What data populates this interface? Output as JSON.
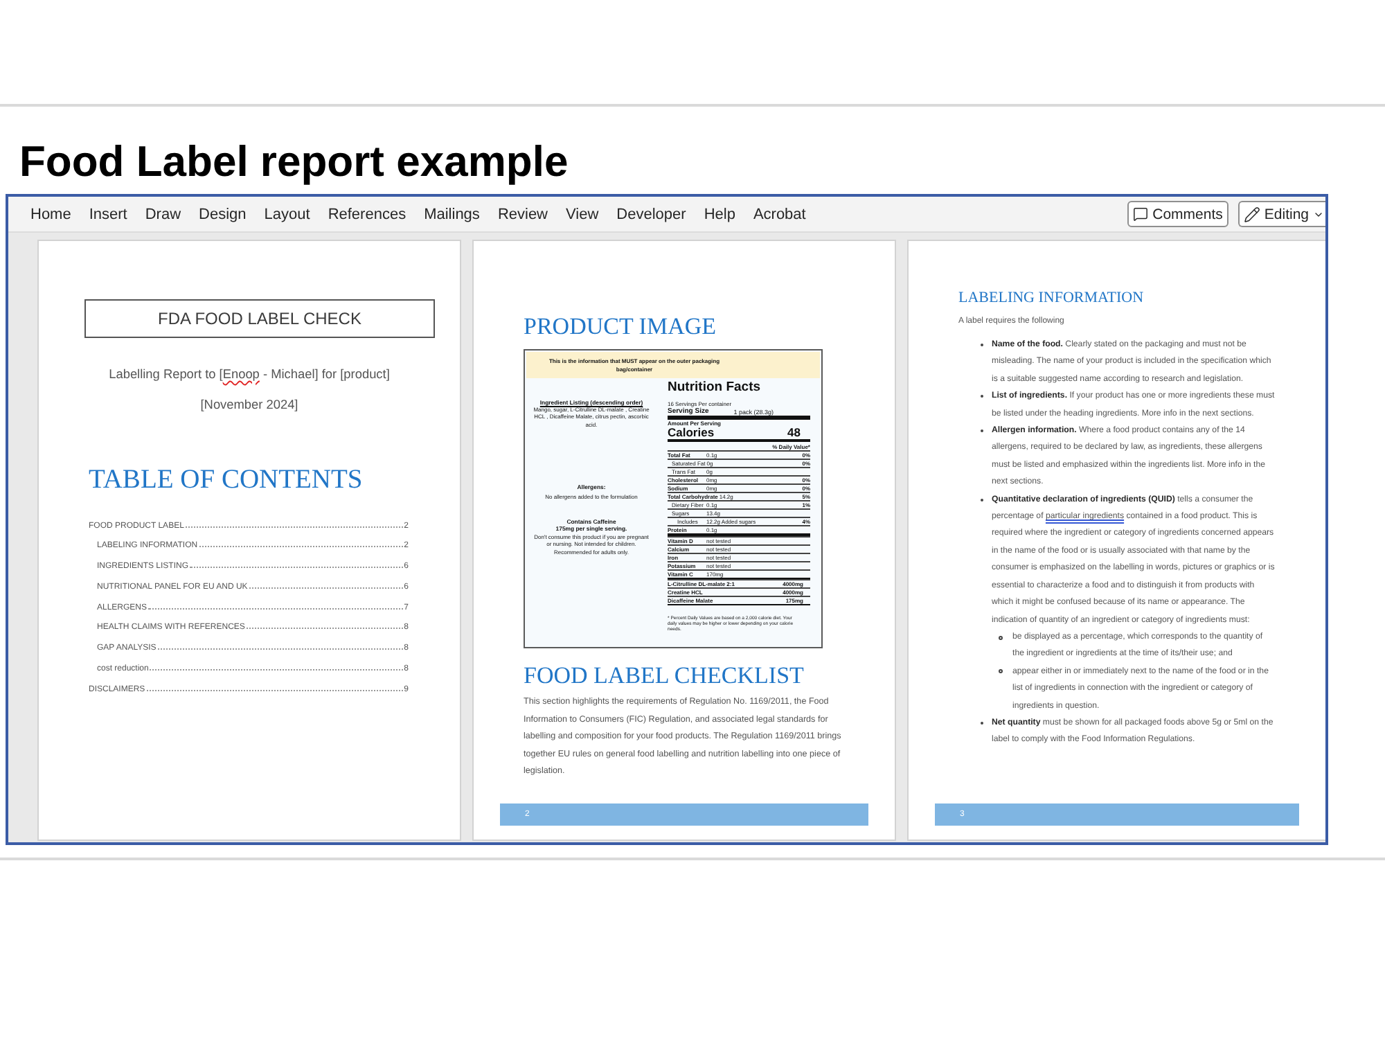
{
  "title": "Food Label report example",
  "ribbon": {
    "tabs": [
      "Home",
      "Insert",
      "Draw",
      "Design",
      "Layout",
      "References",
      "Mailings",
      "Review",
      "View",
      "Developer",
      "Help",
      "Acrobat"
    ],
    "comments_button": "Comments",
    "editing_button": "Editing"
  },
  "page_1": {
    "title_box": "FDA FOOD LABEL CHECK",
    "subtitle": [
      {
        "kind": "text",
        "text": "Labelling Report to ["
      },
      {
        "kind": "spelling_flag",
        "text": "Enoop"
      },
      {
        "kind": "text",
        "text": " - Michael] for [product]"
      }
    ],
    "date": "[November 2024]",
    "toc_heading": "TABLE OF CONTENTS",
    "toc": [
      {
        "title": "FOOD PRODUCT LABEL",
        "page": "2",
        "children": [
          {
            "title": "LABELING INFORMATION",
            "page": "2"
          },
          {
            "title": "INGREDIENTS LISTING",
            "page": "6"
          },
          {
            "title": "NUTRITIONAL PANEL FOR EU AND UK",
            "page": "6"
          },
          {
            "title": "ALLERGENS",
            "page": "7"
          },
          {
            "title": "HEALTH CLAIMS WITH REFERENCES",
            "page": "8"
          },
          {
            "title": "GAP ANALYSIS",
            "page": "8"
          },
          {
            "title": "cost reduction",
            "page": "8"
          }
        ]
      },
      {
        "title": "DISCLAIMERS",
        "page": "9"
      }
    ]
  },
  "page_2": {
    "image_heading": "PRODUCT IMAGE",
    "nutrition_label": {
      "banner": "This is the information that MUST appear on the outer packaging bag/container",
      "ingredients_heading": "Ingredient Listing (descending order)",
      "ingredients": "Mango, sugar, L-Citrulline DL-malate , Creatine HCL , Dicaffeine Malate, citrus pectin, ascorbic acid.",
      "allergens_heading": "Allergens:",
      "allergens": "No allergens added to the formulation",
      "caffeine_heading": "Contains Caffeine",
      "caffeine_amount": "175mg per single serving.",
      "caffeine_warning": "Don't consume this product if you are pregnant or nursing. Not intended for children. Recommended for adults only.",
      "facts_title": "Nutrition Facts",
      "servings": "16 Servings Per container",
      "serving_size_label": "Serving Size",
      "serving_size": "1 pack (28.3g)",
      "amount_per_serving": "Amount Per Serving",
      "calories_label": "Calories",
      "calories": "48",
      "daily_value_heading": "% Daily Value*",
      "nutrients": [
        {
          "kind": "main",
          "name": "Total Fat",
          "amount": "0.1g",
          "dv": "0%"
        },
        {
          "kind": "sub",
          "name": "Saturated Fat",
          "amount": "0g",
          "dv": "0%"
        },
        {
          "kind": "sub",
          "name": "Trans Fat",
          "amount": "0g"
        },
        {
          "kind": "main",
          "name": "Cholesterol",
          "amount": "0mg",
          "dv": "0%"
        },
        {
          "kind": "main",
          "name": "Sodium",
          "amount": "0mg",
          "dv": "0%"
        },
        {
          "kind": "main",
          "name": "Total Carbohydrate",
          "amount": "14.2g",
          "dv": "5%"
        },
        {
          "kind": "sub",
          "name": "Dietary Fiber",
          "amount": "0.1g",
          "dv": "1%"
        },
        {
          "kind": "sub",
          "name": "Sugars",
          "amount": "13.4g"
        },
        {
          "kind": "subsub",
          "name": "Includes",
          "amount": "12.2g Added sugars",
          "dv": "4%"
        },
        {
          "kind": "main",
          "name": "Protein",
          "amount": "0.1g"
        }
      ],
      "vitamins": [
        {
          "name": "Vitamin D",
          "amount": "not tested"
        },
        {
          "name": "Calcium",
          "amount": "not tested"
        },
        {
          "name": "Iron",
          "amount": "not tested"
        },
        {
          "name": "Potassium",
          "amount": "not tested"
        },
        {
          "name": "Vitamin C",
          "amount": "170mg"
        }
      ],
      "actives": [
        {
          "name": "L-Citrulline DL-malate 2:1",
          "amount": "4000mg"
        },
        {
          "name": "Creatine HCL",
          "amount": "4000mg"
        },
        {
          "name": "Dicaffeine Malate",
          "amount": "175mg"
        }
      ],
      "footnote": "* Percent Daily Values are based on a 2,000 calorie diet. Your daily values may be higher or lower depending on your calorie needs."
    },
    "checklist_heading": "FOOD LABEL CHECKLIST",
    "paragraph": "This section highlights the requirements of Regulation No. 1169/2011, the Food Information to Consumers (FIC) Regulation, and associated legal standards for labelling and composition for your food products. The Regulation 1169/2011 brings together EU rules on general food labelling and nutrition labelling into one piece of legislation.",
    "page_number": "2"
  },
  "page_3": {
    "heading": "LABELING INFORMATION",
    "intro": "A label requires the following",
    "bullets": [
      {
        "text": "**Name of the food.** Clearly stated on the packaging and must not be misleading. The name of your product is included in the specification which is a suitable suggested name according to research and legislation."
      },
      {
        "text": "**List of ingredients.** If your product has one or more ingredients these must be listed under the heading ingredients. More info in the next sections."
      },
      {
        "text": "**Allergen information.** Where a food product contains any of the 14 allergens, required to be declared by law, as ingredients, these allergens must be listed and emphasized within the ingredients list. More info in the next sections."
      },
      {
        "segments": [
          {
            "kind": "text",
            "text": "**Quantitative declaration of ingredients (QUID)** tells a consumer the percentage of "
          },
          {
            "kind": "grammar_flag",
            "text": "particular ingredients"
          },
          {
            "kind": "text",
            "text": " contained in a food product. This is required where the ingredient or category of ingredients concerned appears in the name of the food or is usually associated with that name by the consumer is emphasized on the labelling in words, pictures or graphics or is essential to characterize a food and to distinguish it from products with which it might be confused because of its name or appearance. The indication of quantity of an ingredient or category of ingredients must:"
          }
        ],
        "children": [
          {
            "text": "be displayed as a percentage, which corresponds to the quantity of the ingredient or ingredients at the time of its/their use; and"
          },
          {
            "text": "appear either in or immediately next to the name of the food or in the list of ingredients in connection with the ingredient or category of ingredients in question."
          }
        ]
      },
      {
        "text": "**Net quantity** must be shown for all packaged foods above 5g or 5ml on the label to comply with the Food Information Regulations."
      }
    ],
    "page_number": "3"
  }
}
